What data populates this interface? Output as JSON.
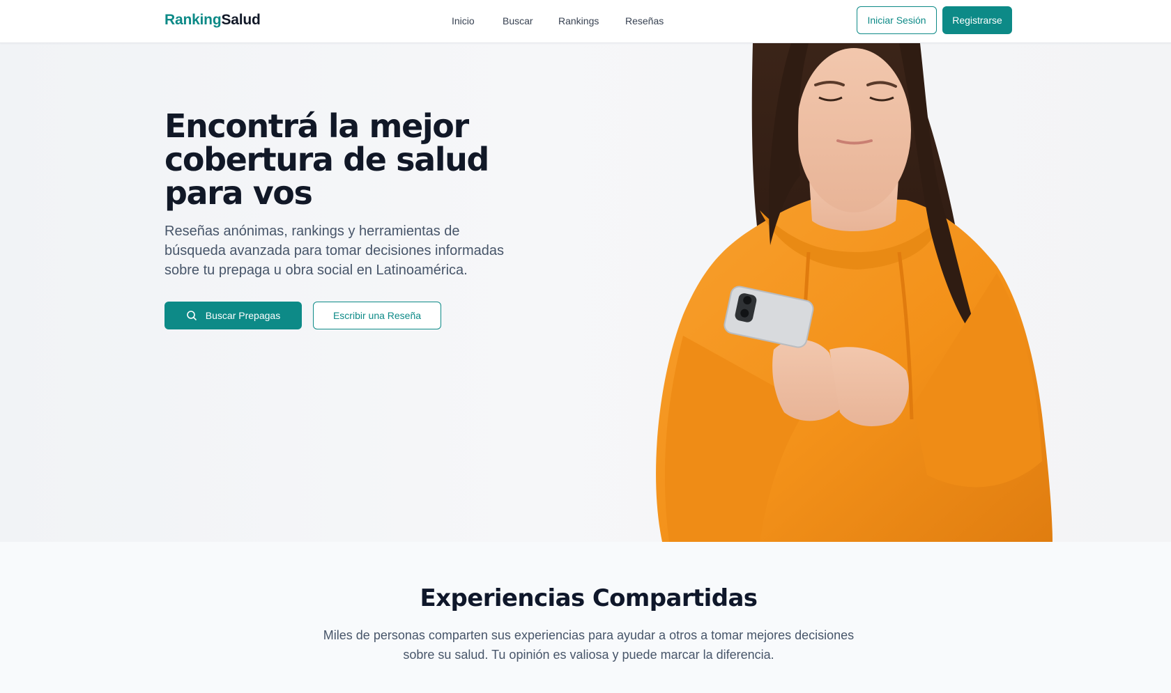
{
  "brand": {
    "name_part_a": "Ranking",
    "name_part_b": "Salud"
  },
  "nav": {
    "items": [
      "Inicio",
      "Buscar",
      "Rankings",
      "Reseñas"
    ]
  },
  "auth": {
    "login_label": "Iniciar Sesión",
    "register_label": "Registrarse"
  },
  "hero": {
    "title": "Encontrá la mejor cobertura de salud para vos",
    "subtitle": "Reseñas anónimas, rankings y herramientas de búsqueda avanzada para tomar decisiones informadas sobre tu prepaga u obra social en Latinoamérica.",
    "primary_cta": "Buscar Prepagas",
    "secondary_cta": "Escribir una Reseña",
    "primary_cta_icon": "search-icon",
    "image_subject": "woman in orange hoodie using smartphone"
  },
  "section": {
    "title": "Experiencias Compartidas",
    "subtitle": "Miles de personas comparten sus experiencias para ayudar a otros a tomar mejores decisiones sobre su salud. Tu opinión es valiosa y puede marcar la diferencia."
  },
  "colors": {
    "accent": "#0d8a87",
    "heading": "#111827",
    "body_text": "#475569",
    "hoodie": "#f5921e",
    "background": "#f8fafc"
  }
}
